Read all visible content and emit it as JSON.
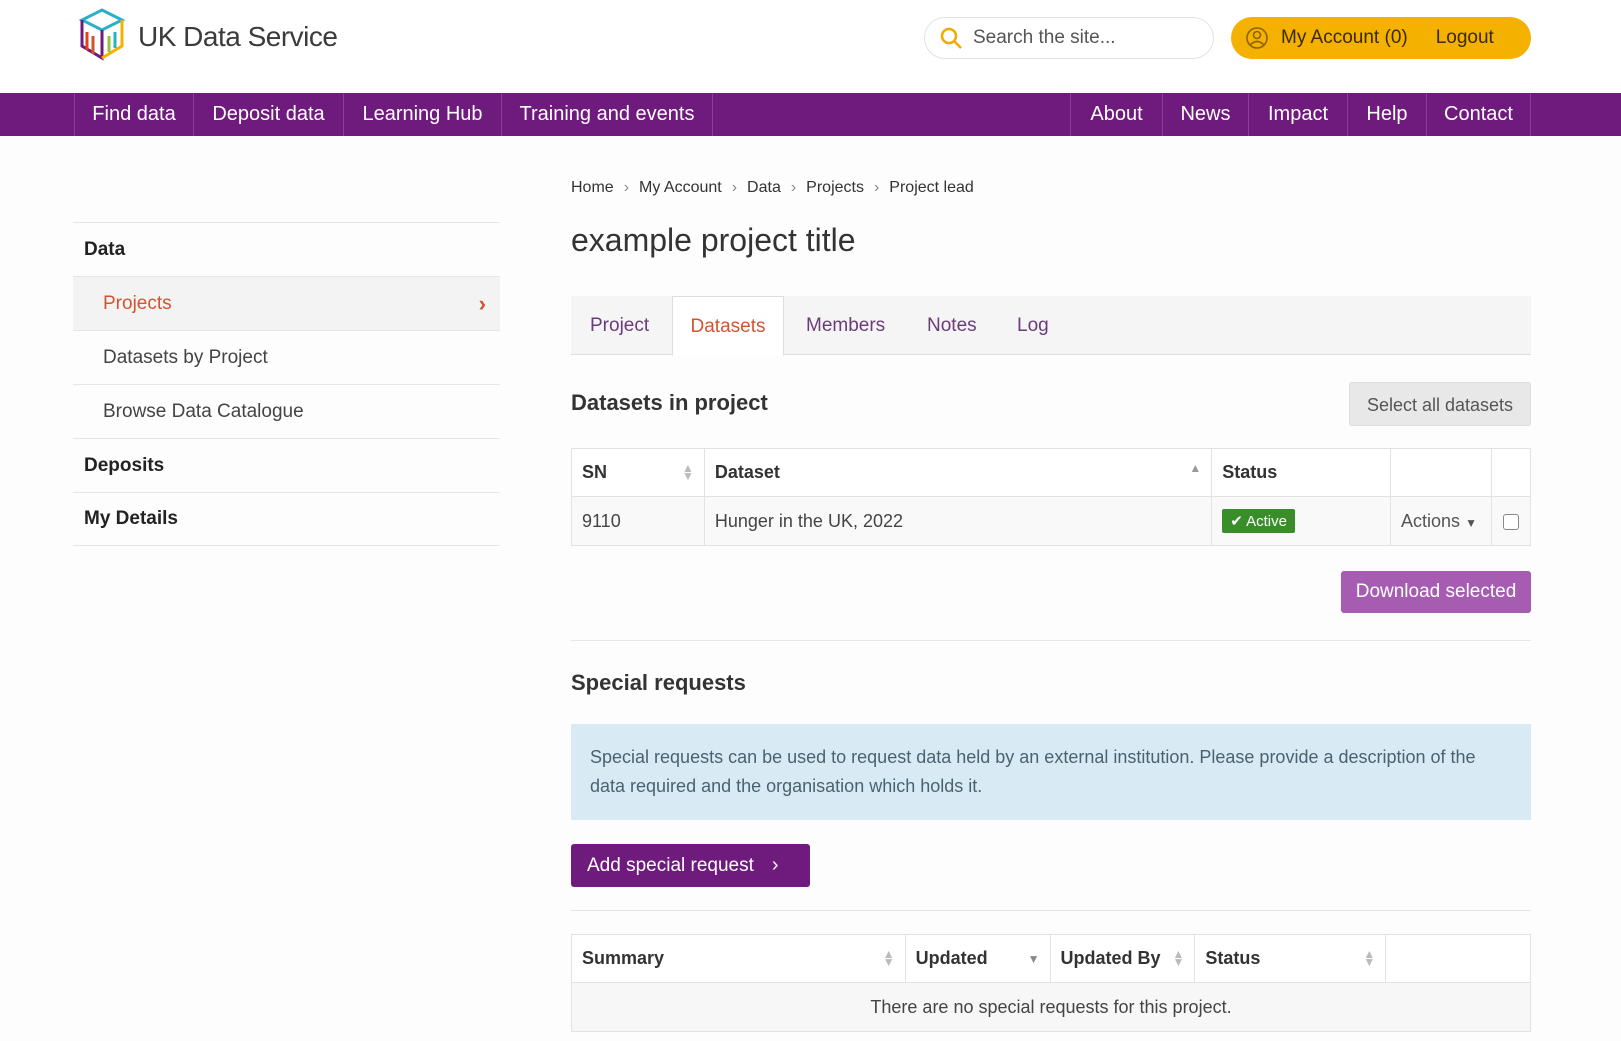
{
  "header": {
    "brand": "UK Data Service",
    "search_placeholder": "Search the site...",
    "account_label": "My Account (0)",
    "logout_label": "Logout",
    "accent": "#f5b100"
  },
  "nav": {
    "left": [
      "Find data",
      "Deposit data",
      "Learning Hub",
      "Training and events"
    ],
    "right": [
      "About",
      "News",
      "Impact",
      "Help",
      "Contact"
    ],
    "color": "#6e1b7d"
  },
  "breadcrumb": [
    "Home",
    "My Account",
    "Data",
    "Projects",
    "Project lead"
  ],
  "sidebar": {
    "data_heading": "Data",
    "items": [
      "Projects",
      "Datasets by Project",
      "Browse Data Catalogue"
    ],
    "deposits": "Deposits",
    "my_details": "My Details"
  },
  "page_title": "example project title",
  "tabs": [
    "Project",
    "Datasets",
    "Members",
    "Notes",
    "Log"
  ],
  "datasets": {
    "heading": "Datasets in project",
    "select_all": "Select all datasets",
    "columns": [
      "SN",
      "Dataset",
      "Status"
    ],
    "rows": [
      {
        "sn": "9110",
        "dataset": "Hunger in the UK, 2022",
        "status": "Active",
        "actions": "Actions"
      }
    ],
    "download": "Download selected"
  },
  "special": {
    "heading": "Special requests",
    "info": "Special requests can be used to request data held by an external institution. Please provide a description of the data required and the organisation which holds it.",
    "add_button": "Add special request",
    "columns": [
      "Summary",
      "Updated",
      "Updated By",
      "Status"
    ],
    "empty": "There are no special requests for this project."
  }
}
